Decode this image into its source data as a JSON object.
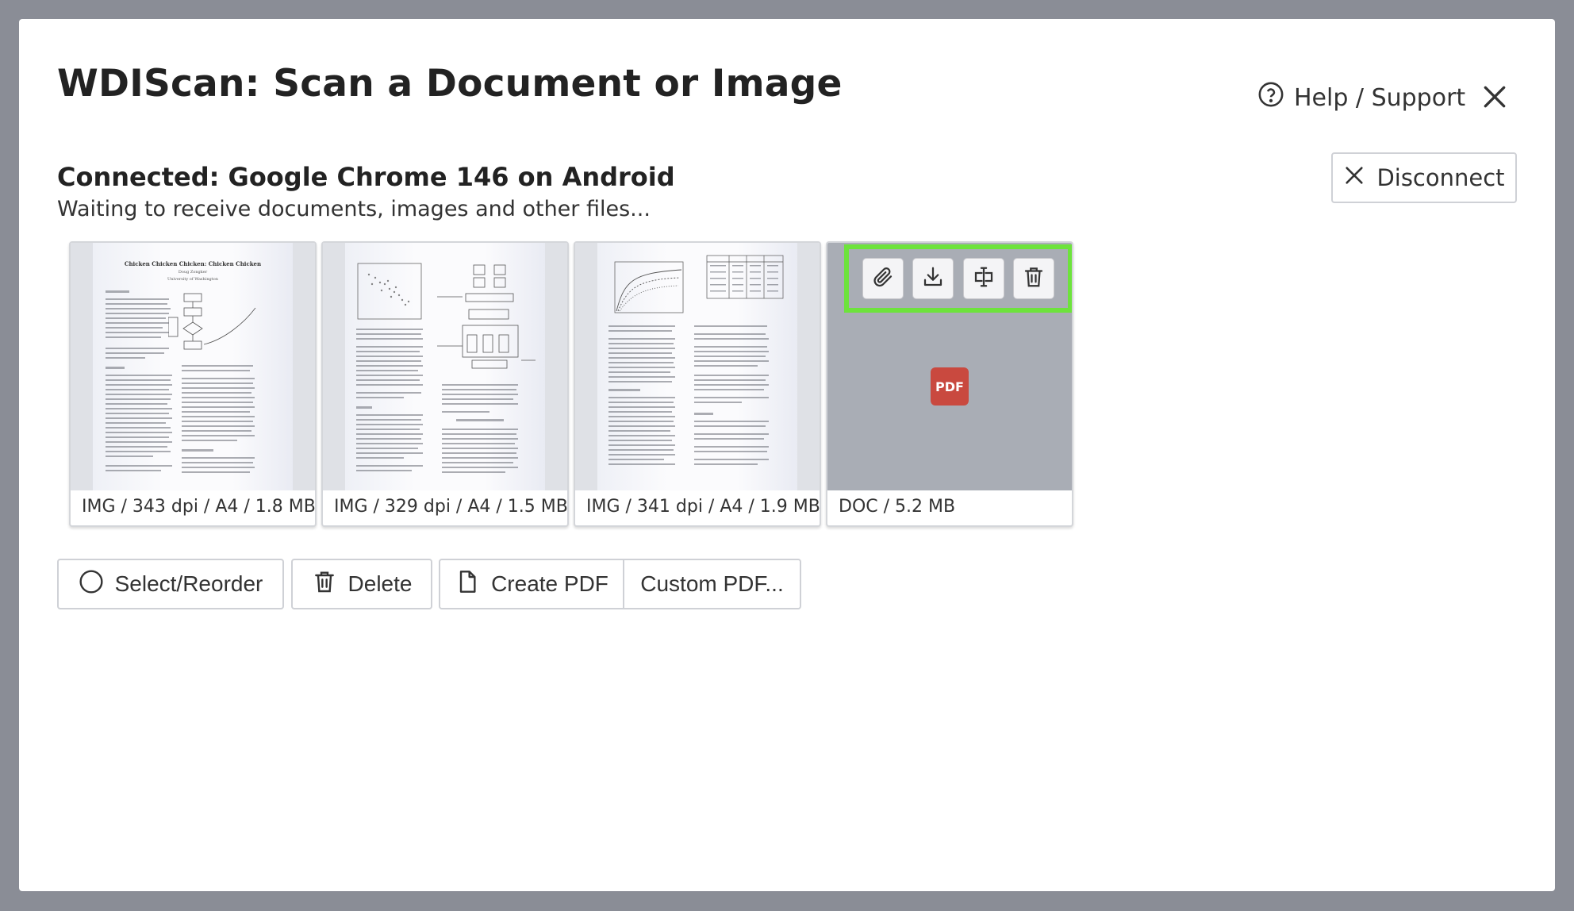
{
  "dialog": {
    "title": "WDIScan: Scan a Document or Image",
    "help_label": "Help / Support",
    "help_icon": "help-circle-icon",
    "close_icon": "close-icon"
  },
  "connection": {
    "title": "Connected: Google Chrome 146 on Android",
    "status": "Waiting to receive documents, images and other files...",
    "disconnect_label": "Disconnect",
    "disconnect_icon": "close-icon"
  },
  "files": [
    {
      "type": "IMG",
      "caption": "IMG / 343 dpi / A4 / 1.8 MB",
      "preview_heading": "Chicken Chicken Chicken: Chicken Chicken",
      "preview_author": "Doug Zongker",
      "preview_affiliation": "University of Washington"
    },
    {
      "type": "IMG",
      "caption": "IMG / 329 dpi / A4 / 1.5 MB"
    },
    {
      "type": "IMG",
      "caption": "IMG / 341 dpi / A4 / 1.9 MB"
    },
    {
      "type": "DOC",
      "caption": "DOC / 5.2 MB",
      "badge": "PDF"
    }
  ],
  "file_actions": [
    {
      "icon": "paperclip-icon"
    },
    {
      "icon": "download-icon"
    },
    {
      "icon": "rename-icon"
    },
    {
      "icon": "trash-icon"
    }
  ],
  "action_highlight_color": "#6de33c",
  "toolbar": {
    "select_label": "Select/Reorder",
    "delete_label": "Delete",
    "create_pdf_label": "Create PDF",
    "custom_pdf_label": "Custom PDF..."
  },
  "colors": {
    "overlay": "#8a8d96",
    "pdf_badge": "#c9493f"
  }
}
